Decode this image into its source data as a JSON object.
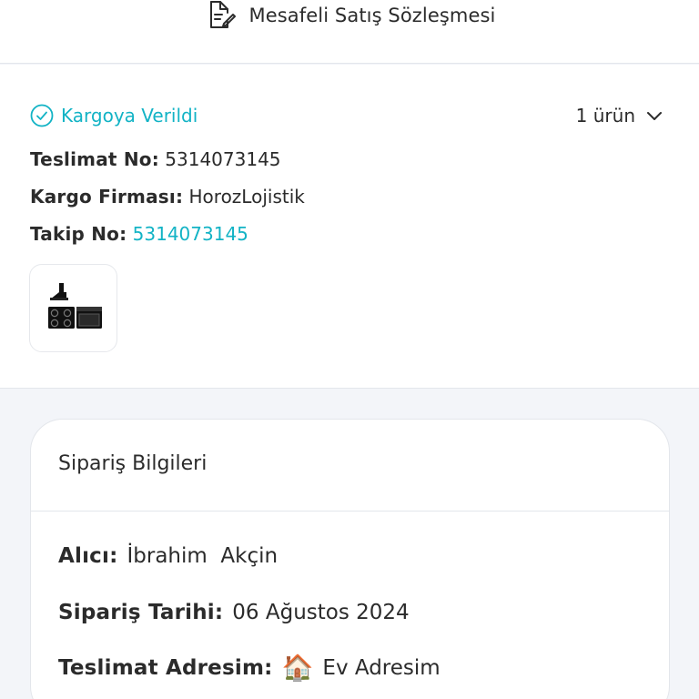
{
  "header": {
    "contract_label": "Mesafeli Satış Sözleşmesi",
    "contract_icon": "document-edit-icon"
  },
  "shipment": {
    "status_label": "Kargoya Verildi",
    "status_icon": "check-circle-icon",
    "status_color": "#12b3c5",
    "item_count_label": "1 ürün",
    "delivery_no_key": "Teslimat No:",
    "delivery_no_value": "5314073145",
    "carrier_key": "Kargo Firması:",
    "carrier_value": "HorozLojistik",
    "tracking_key": "Takip No:",
    "tracking_value": "5314073145",
    "product_thumbnail": "built-in-appliance-set-image"
  },
  "order_info": {
    "title": "Sipariş Bilgileri",
    "recipient_key": "Alıcı:",
    "recipient_value": "İbrahim  Akçin",
    "date_key": "Sipariş Tarihi:",
    "date_value": "06 Ağustos 2024",
    "address_key": "Teslimat Adresim:",
    "address_icon": "house-icon",
    "address_glyph": "🏠",
    "address_value": "Ev Adresim"
  }
}
